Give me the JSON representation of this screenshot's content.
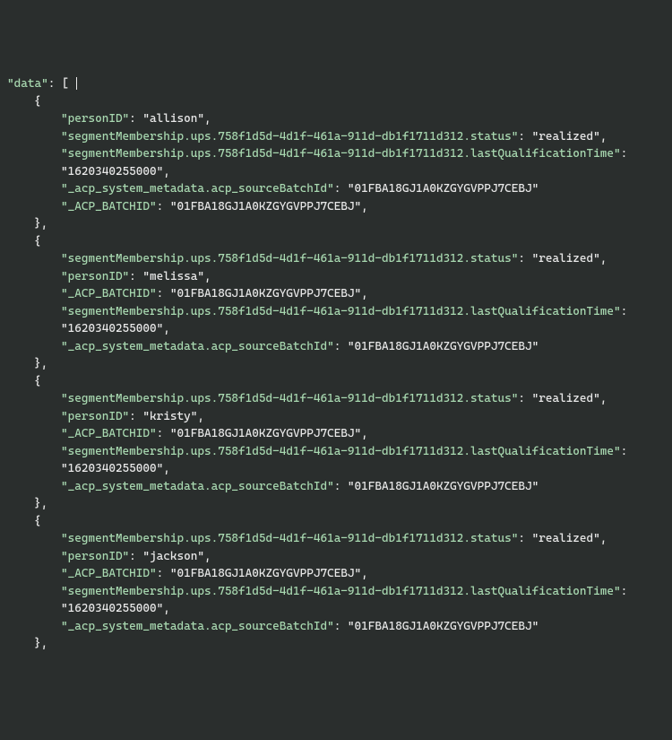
{
  "root_key": "\"data\"",
  "open_bracket": "[",
  "open_brace": "{",
  "close_brace": "}",
  "close_brace_comma": "},",
  "records": [
    {
      "lines": [
        {
          "k": "\"personID\"",
          "v": "\"allison\"",
          "comma": true
        },
        {
          "k": "\"segmentMembership.ups.758f1d5d-4d1f-461a-911d-db1f1711d312.status\"",
          "v": "\"realized\"",
          "comma": true
        },
        {
          "k": "\"segmentMembership.ups.758f1d5d-4d1f-461a-911d-db1f1711d312.lastQualificationTime\"",
          "v": null,
          "comma": false
        },
        {
          "k": null,
          "v": "\"1620340255000\"",
          "comma": true
        },
        {
          "k": "\"_acp_system_metadata.acp_sourceBatchId\"",
          "v": "\"01FBA18GJ1A0KZGYGVPPJ7CEBJ\"",
          "comma": false
        },
        {
          "k": "\"_ACP_BATCHID\"",
          "v": "\"01FBA18GJ1A0KZGYGVPPJ7CEBJ\"",
          "comma": true
        }
      ]
    },
    {
      "lines": [
        {
          "k": "\"segmentMembership.ups.758f1d5d-4d1f-461a-911d-db1f1711d312.status\"",
          "v": "\"realized\"",
          "comma": true
        },
        {
          "k": "\"personID\"",
          "v": "\"melissa\"",
          "comma": true
        },
        {
          "k": "\"_ACP_BATCHID\"",
          "v": "\"01FBA18GJ1A0KZGYGVPPJ7CEBJ\"",
          "comma": true
        },
        {
          "k": "\"segmentMembership.ups.758f1d5d-4d1f-461a-911d-db1f1711d312.lastQualificationTime\"",
          "v": null,
          "comma": false
        },
        {
          "k": null,
          "v": "\"1620340255000\"",
          "comma": true
        },
        {
          "k": "\"_acp_system_metadata.acp_sourceBatchId\"",
          "v": "\"01FBA18GJ1A0KZGYGVPPJ7CEBJ\"",
          "comma": false
        }
      ]
    },
    {
      "lines": [
        {
          "k": "\"segmentMembership.ups.758f1d5d-4d1f-461a-911d-db1f1711d312.status\"",
          "v": "\"realized\"",
          "comma": true
        },
        {
          "k": "\"personID\"",
          "v": "\"kristy\"",
          "comma": true
        },
        {
          "k": "\"_ACP_BATCHID\"",
          "v": "\"01FBA18GJ1A0KZGYGVPPJ7CEBJ\"",
          "comma": true
        },
        {
          "k": "\"segmentMembership.ups.758f1d5d-4d1f-461a-911d-db1f1711d312.lastQualificationTime\"",
          "v": null,
          "comma": false
        },
        {
          "k": null,
          "v": "\"1620340255000\"",
          "comma": true
        },
        {
          "k": "\"_acp_system_metadata.acp_sourceBatchId\"",
          "v": "\"01FBA18GJ1A0KZGYGVPPJ7CEBJ\"",
          "comma": false
        }
      ]
    },
    {
      "lines": [
        {
          "k": "\"segmentMembership.ups.758f1d5d-4d1f-461a-911d-db1f1711d312.status\"",
          "v": "\"realized\"",
          "comma": true
        },
        {
          "k": "\"personID\"",
          "v": "\"jackson\"",
          "comma": true
        },
        {
          "k": "\"_ACP_BATCHID\"",
          "v": "\"01FBA18GJ1A0KZGYGVPPJ7CEBJ\"",
          "comma": true
        },
        {
          "k": "\"segmentMembership.ups.758f1d5d-4d1f-461a-911d-db1f1711d312.lastQualificationTime\"",
          "v": null,
          "comma": false
        },
        {
          "k": null,
          "v": "\"1620340255000\"",
          "comma": true
        },
        {
          "k": "\"_acp_system_metadata.acp_sourceBatchId\"",
          "v": "\"01FBA18GJ1A0KZGYGVPPJ7CEBJ\"",
          "comma": false
        }
      ]
    }
  ]
}
